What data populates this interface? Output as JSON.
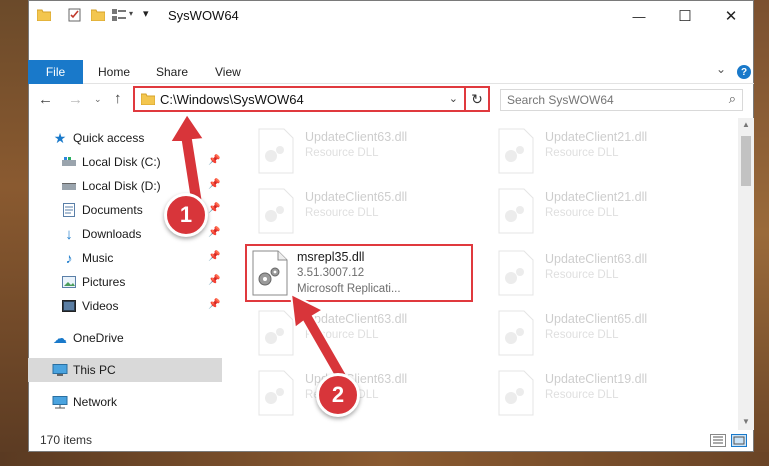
{
  "window": {
    "title": "SysWOW64",
    "minimize_glyph": "—",
    "maximize_glyph": "☐",
    "close_glyph": "✕"
  },
  "ribbon": {
    "file": "File",
    "home": "Home",
    "share": "Share",
    "view": "View",
    "help": "?",
    "collapse": "⌄"
  },
  "address": {
    "path": "C:\\Windows\\SysWOW64",
    "search_placeholder": "Search SysWOW64"
  },
  "nav": {
    "quick_access": "Quick access",
    "items": [
      {
        "label": "Local Disk (C:)"
      },
      {
        "label": "Local Disk (D:)"
      },
      {
        "label": "Documents"
      },
      {
        "label": "Downloads"
      },
      {
        "label": "Music"
      },
      {
        "label": "Pictures"
      },
      {
        "label": "Videos"
      }
    ],
    "onedrive": "OneDrive",
    "this_pc": "This PC",
    "network": "Network"
  },
  "files": {
    "col1": [
      {
        "name": "UpdateClient63.dll",
        "desc": "Resource DLL"
      },
      {
        "name": "UpdateClient65.dll",
        "desc": "Resource DLL"
      },
      {
        "name": "msrepl35.dll",
        "version": "3.51.3007.12",
        "desc": "Microsoft Replicati..."
      },
      {
        "name": "UpdateClient63.dll",
        "desc": "Resource DLL"
      },
      {
        "name": "UpdateClient63.dll",
        "desc": "Resource DLL"
      }
    ],
    "col2": [
      {
        "name": "UpdateClient21.dll",
        "desc": "Resource DLL"
      },
      {
        "name": "UpdateClient21.dll",
        "desc": "Resource DLL"
      },
      {
        "name": "UpdateClient63.dll",
        "desc": "Resource DLL"
      },
      {
        "name": "UpdateClient65.dll",
        "desc": "Resource DLL"
      },
      {
        "name": "UpdateClient19.dll",
        "desc": "Resource DLL"
      }
    ]
  },
  "status": {
    "item_count": "170 items"
  },
  "callouts": {
    "one": "1",
    "two": "2"
  },
  "colors": {
    "accent": "#1979ca",
    "highlight": "#e0393e",
    "callout": "#d8353a"
  }
}
